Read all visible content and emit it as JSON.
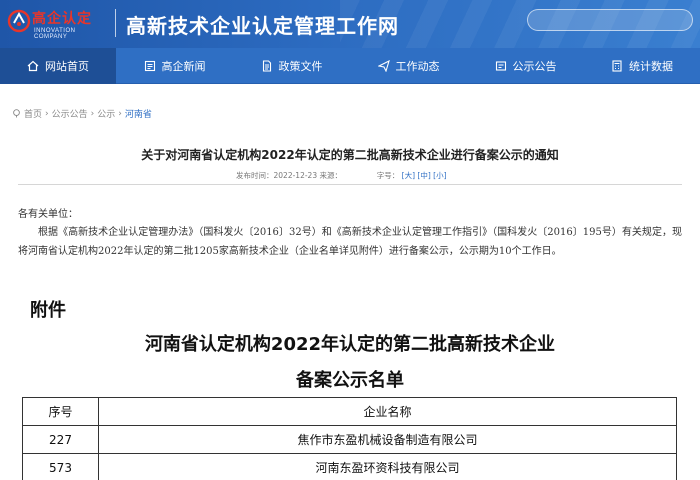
{
  "header": {
    "logo_text": "高企认定",
    "logo_subtext": "INNOVATION COMPANY",
    "site_title": "高新技术企业认定管理工作网",
    "search_placeholder": "",
    "colors": {
      "header_bg": "#2560b4",
      "nav_bg": "#2f6fc4",
      "nav_active": "#1e4f96",
      "logo_red": "#e8352a",
      "link": "#2f6fc4"
    }
  },
  "nav": {
    "items": [
      {
        "label": "网站首页",
        "icon": "home-icon",
        "active": true
      },
      {
        "label": "高企新闻",
        "icon": "news-icon",
        "active": false
      },
      {
        "label": "政策文件",
        "icon": "document-icon",
        "active": false
      },
      {
        "label": "工作动态",
        "icon": "send-icon",
        "active": false
      },
      {
        "label": "公示公告",
        "icon": "notice-icon",
        "active": false
      },
      {
        "label": "统计数据",
        "icon": "calculator-icon",
        "active": false
      }
    ]
  },
  "breadcrumb": {
    "items": [
      "首页",
      "公示公告",
      "公示",
      "河南省"
    ],
    "separator": "›"
  },
  "article": {
    "title": "关于对河南省认定机构2022年认定的第二批高新技术企业进行备案公示的通知",
    "meta_prefix": "发布时间：2022-12-23 来源：",
    "meta_fontsize_label": "字号：",
    "font_large": "[大]",
    "font_medium": "[中]",
    "font_small": "[小]",
    "salutation": "各有关单位：",
    "body": "根据《高新技术企业认定管理办法》（国科发火〔2016〕32号）和《高新技术企业认定管理工作指引》（国科发火〔2016〕195号）有关规定，现将河南省认定机构2022年认定的第二批1205家高新技术企业（企业名单详见附件）进行备案公示，公示期为10个工作日。",
    "attachment_label": "附件",
    "list_title_line1": "河南省认定机构2022年认定的第二批高新技术企业",
    "list_title_line2": "备案公示名单"
  },
  "table": {
    "headers": [
      "序号",
      "企业名称"
    ],
    "rows": [
      [
        "227",
        "焦作市东盈机械设备制造有限公司"
      ],
      [
        "573",
        "河南东盈环资科技有限公司"
      ]
    ]
  }
}
